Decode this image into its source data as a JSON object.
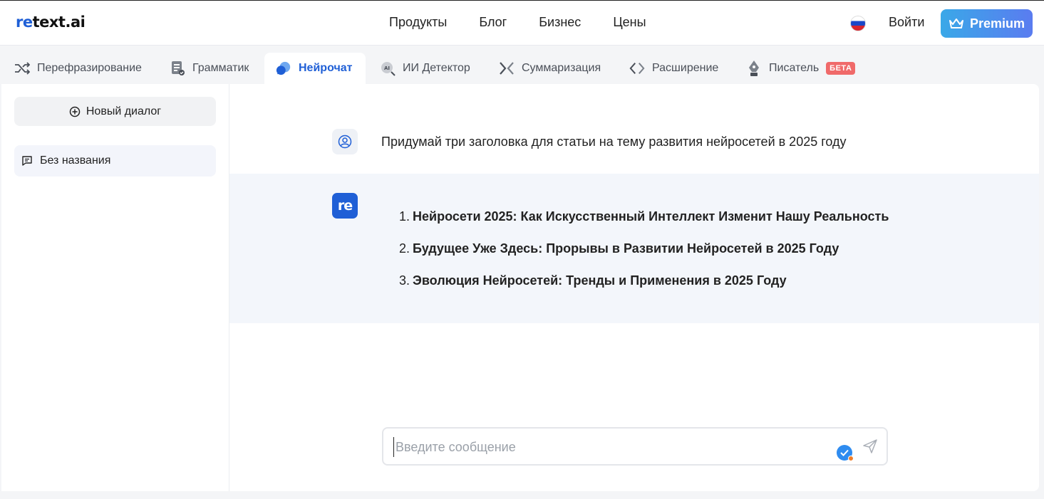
{
  "header": {
    "logo_prefix": "re",
    "logo_suffix": "text.ai",
    "nav": [
      "Продукты",
      "Блог",
      "Бизнес",
      "Цены"
    ],
    "login_label": "Войти",
    "premium_label": "Premium"
  },
  "tabs": [
    {
      "label": "Перефразирование",
      "icon": "shuffle-icon"
    },
    {
      "label": "Грамматик",
      "icon": "document-check-icon"
    },
    {
      "label": "Нейрочат",
      "icon": "chat-bubbles-icon",
      "active": true
    },
    {
      "label": "ИИ Детектор",
      "icon": "ai-magnifier-icon"
    },
    {
      "label": "Суммаризация",
      "icon": "collapse-arrows-icon"
    },
    {
      "label": "Расширение",
      "icon": "expand-arrows-icon"
    },
    {
      "label": "Писатель",
      "icon": "pen-nib-icon",
      "badge": "БЕТА"
    }
  ],
  "sidebar": {
    "new_dialog_label": "Новый диалог",
    "chats": [
      {
        "label": "Без названия"
      }
    ]
  },
  "conversation": {
    "user_message": "Придумай три заголовка для статьи на тему развития нейросетей в 2025 году",
    "bot_avatar_label": "re",
    "answers": [
      {
        "num": "1.",
        "text": "Нейросети 2025: Как Искусственный Интеллект Изменит Нашу Реальность"
      },
      {
        "num": "2.",
        "text": "Будущее Уже Здесь: Прорывы в Развитии Нейросетей в 2025 Году"
      },
      {
        "num": "3.",
        "text": "Эволюция Нейросетей: Тренды и Применения в 2025 Году"
      }
    ]
  },
  "composer": {
    "placeholder": "Введите сообщение",
    "value": ""
  },
  "colors": {
    "accent": "#1f5fd6",
    "premium_gradient_start": "#3aa8e8",
    "premium_gradient_end": "#5a7cf0",
    "beta_badge": "#f06a6a"
  }
}
